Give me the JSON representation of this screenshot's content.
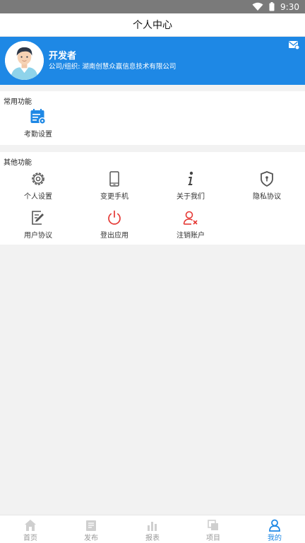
{
  "status_bar": {
    "time": "9:30",
    "icons": [
      "wifi-icon",
      "battery-icon"
    ]
  },
  "header": {
    "title": "个人中心"
  },
  "profile": {
    "name": "开发者",
    "company": "公司/组织: 湖南创慧众赢信息技术有限公司",
    "mail_icon": "mail-icon"
  },
  "common": {
    "title": "常用功能",
    "items": [
      {
        "label": "考勤设置",
        "icon": "attendance-settings-icon"
      }
    ]
  },
  "other": {
    "title": "其他功能",
    "items": [
      {
        "label": "个人设置",
        "icon": "gear-icon"
      },
      {
        "label": "变更手机",
        "icon": "phone-icon"
      },
      {
        "label": "关于我们",
        "icon": "info-icon"
      },
      {
        "label": "隐私协议",
        "icon": "shield-icon"
      },
      {
        "label": "用户协议",
        "icon": "document-edit-icon"
      },
      {
        "label": "登出应用",
        "icon": "power-icon"
      },
      {
        "label": "注销账户",
        "icon": "user-remove-icon"
      }
    ]
  },
  "tabs": [
    {
      "label": "首页",
      "icon": "home-icon"
    },
    {
      "label": "发布",
      "icon": "publish-icon"
    },
    {
      "label": "报表",
      "icon": "report-icon"
    },
    {
      "label": "项目",
      "icon": "project-icon"
    },
    {
      "label": "我的",
      "icon": "user-icon",
      "active": true
    }
  ],
  "colors": {
    "primary": "#1e88e5",
    "danger": "#e53935",
    "icon_gray": "#555555",
    "tab_inactive": "#999999"
  }
}
